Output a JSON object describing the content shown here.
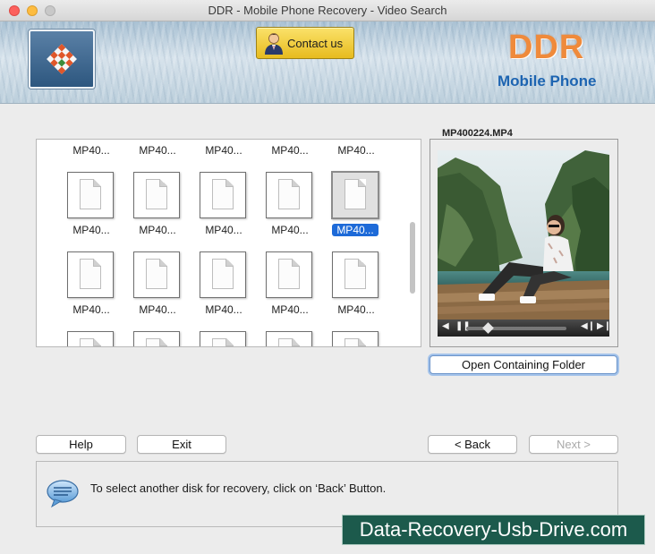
{
  "window": {
    "title": "DDR - Mobile Phone Recovery - Video Search"
  },
  "header": {
    "contact_label": "Contact us",
    "brand": "DDR",
    "brand_sub": "Mobile Phone"
  },
  "grid": {
    "top_labels": [
      "MP40...",
      "MP40...",
      "MP40...",
      "MP40...",
      "MP40..."
    ],
    "row1": [
      "MP40...",
      "MP40...",
      "MP40...",
      "MP40...",
      "MP40..."
    ],
    "row2": [
      "MP40...",
      "MP40...",
      "MP40...",
      "MP40...",
      "MP40..."
    ],
    "selected_index": 4
  },
  "preview": {
    "label": "MP400224.MP4",
    "open_folder_label": "Open Containing Folder"
  },
  "buttons": {
    "help": "Help",
    "exit": "Exit",
    "back": "< Back",
    "next": "Next >"
  },
  "message": {
    "text": "To select another disk for recovery, click on ‘Back’ Button."
  },
  "watermark": "Data-Recovery-Usb-Drive.com",
  "colors": {
    "brand_orange": "#ef8a3b",
    "brand_blue": "#1d64b1",
    "selection": "#1d6ad8",
    "contact_button": "#f3cf3a"
  }
}
